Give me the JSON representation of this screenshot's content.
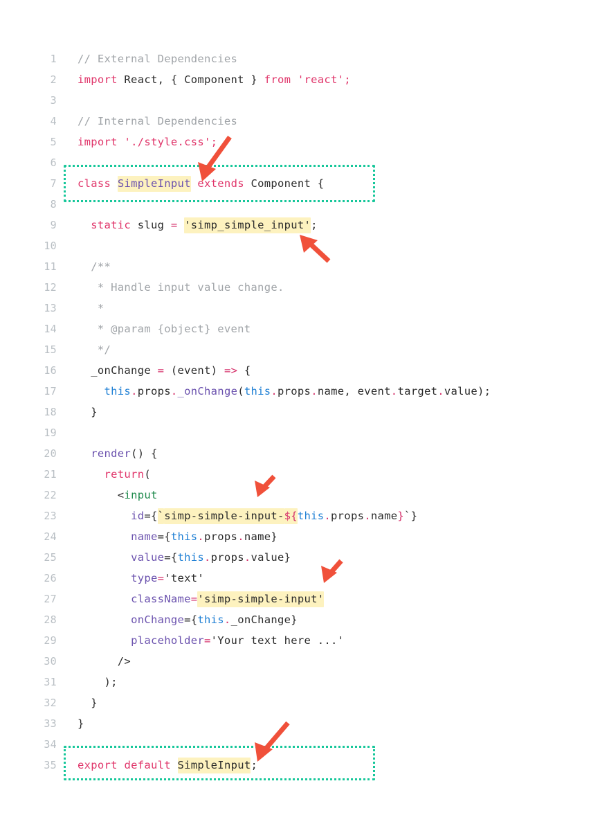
{
  "document": {
    "type": "code-screenshot",
    "language": "jsx",
    "filename_hint": "SimpleInput",
    "total_lines": 35
  },
  "colors": {
    "background": "#ffffff",
    "gutter_text": "#b9bfc4",
    "default_text": "#2b2b2b",
    "keyword": "#e0356a",
    "string": "#2b2b2b",
    "comment": "#a0a4a8",
    "class_name": "#6b52ae",
    "attribute": "#6b52ae",
    "this_keyword": "#1e7fd4",
    "jsx_tag": "#1f8a4c",
    "highlight": "#fdf2bf",
    "callout_box": "#16c79a",
    "arrow": "#f0503a"
  },
  "lines": [
    {
      "n": "1",
      "text": "// External Dependencies"
    },
    {
      "n": "2",
      "text": "import React, { Component } from 'react';"
    },
    {
      "n": "3",
      "text": ""
    },
    {
      "n": "4",
      "text": "// Internal Dependencies"
    },
    {
      "n": "5",
      "text": "import './style.css';"
    },
    {
      "n": "6",
      "text": ""
    },
    {
      "n": "7",
      "text": "class SimpleInput extends Component {"
    },
    {
      "n": "8",
      "text": ""
    },
    {
      "n": "9",
      "text": "  static slug = 'simp_simple_input';"
    },
    {
      "n": "10",
      "text": ""
    },
    {
      "n": "11",
      "text": "  /**"
    },
    {
      "n": "12",
      "text": "   * Handle input value change."
    },
    {
      "n": "13",
      "text": "   *"
    },
    {
      "n": "14",
      "text": "   * @param {object} event"
    },
    {
      "n": "15",
      "text": "   */"
    },
    {
      "n": "16",
      "text": "  _onChange = (event) => {"
    },
    {
      "n": "17",
      "text": "    this.props._onChange(this.props.name, event.target.value);"
    },
    {
      "n": "18",
      "text": "  }"
    },
    {
      "n": "19",
      "text": ""
    },
    {
      "n": "20",
      "text": "  render() {"
    },
    {
      "n": "21",
      "text": "    return("
    },
    {
      "n": "22",
      "text": "      <input"
    },
    {
      "n": "23",
      "text": "        id={`simp-simple-input-${this.props.name}`}"
    },
    {
      "n": "24",
      "text": "        name={this.props.name}"
    },
    {
      "n": "25",
      "text": "        value={this.props.value}"
    },
    {
      "n": "26",
      "text": "        type='text'"
    },
    {
      "n": "27",
      "text": "        className='simp-simple-input'"
    },
    {
      "n": "28",
      "text": "        onChange={this._onChange}"
    },
    {
      "n": "29",
      "text": "        placeholder='Your text here ...'"
    },
    {
      "n": "30",
      "text": "      />"
    },
    {
      "n": "31",
      "text": "    );"
    },
    {
      "n": "32",
      "text": "  }"
    },
    {
      "n": "33",
      "text": "}"
    },
    {
      "n": "34",
      "text": ""
    },
    {
      "n": "35",
      "text": "export default SimpleInput;"
    }
  ],
  "line_numbers": {
    "l1": "1",
    "l2": "2",
    "l3": "3",
    "l4": "4",
    "l5": "5",
    "l6": "6",
    "l7": "7",
    "l8": "8",
    "l9": "9",
    "l10": "10",
    "l11": "11",
    "l12": "12",
    "l13": "13",
    "l14": "14",
    "l15": "15",
    "l16": "16",
    "l17": "17",
    "l18": "18",
    "l19": "19",
    "l20": "20",
    "l21": "21",
    "l22": "22",
    "l23": "23",
    "l24": "24",
    "l25": "25",
    "l26": "26",
    "l27": "27",
    "l28": "28",
    "l29": "29",
    "l30": "30",
    "l31": "31",
    "l32": "32",
    "l33": "33",
    "l34": "34",
    "l35": "35"
  },
  "tokens": {
    "l1": {
      "comment": "// External Dependencies"
    },
    "l2": {
      "import": "import",
      "react_ident": " React, { Component } ",
      "from": "from",
      "space": " ",
      "module": "'react';"
    },
    "l4": {
      "comment": "// Internal Dependencies"
    },
    "l5": {
      "import": "import",
      "space": " ",
      "module": "'./style.css';"
    },
    "l7": {
      "class_kw": "class",
      "sp1": " ",
      "name": "SimpleInput",
      "sp2": " ",
      "extends_kw": "extends",
      "sp3": " ",
      "base": "Component {"
    },
    "l9": {
      "indent": "  ",
      "static_kw": "static",
      "sp1": " ",
      "ident": "slug",
      "sp2": " ",
      "eq": "=",
      "sp3": " ",
      "value": "'simp_simple_input'",
      "semi": ";"
    },
    "l11": {
      "text": "  /**"
    },
    "l12": {
      "text": "   * Handle input value change."
    },
    "l13": {
      "text": "   *"
    },
    "l14": {
      "text": "   * @param {object} event"
    },
    "l15": {
      "text": "   */"
    },
    "l16": {
      "indent": "  ",
      "ident": "_onChange",
      "sp1": " ",
      "eq": "=",
      "sp2": " ",
      "params": "(event)",
      "sp3": " ",
      "arrow": "=>",
      "brace": " {"
    },
    "l17": {
      "indent": "    ",
      "this1": "this",
      "dot1": ".",
      "props1": "props",
      "dot2": ".",
      "method": "_onChange",
      "paren": "(",
      "this2": "this",
      "dot3": ".",
      "props2": "props",
      "dot4": ".",
      "name": "name",
      "comma": ", ",
      "event": "event",
      "dot5": ".",
      "target": "target",
      "dot6": ".",
      "value": "value",
      "close": ");"
    },
    "l18": {
      "text": "  }"
    },
    "l20": {
      "indent": "  ",
      "fn": "render",
      "rest": "() {"
    },
    "l21": {
      "indent": "    ",
      "return_kw": "return",
      "paren": "("
    },
    "l22": {
      "indent": "      ",
      "lt": "<",
      "tag": "input"
    },
    "l23": {
      "indent": "        ",
      "attr": "id",
      "eqbrace": "={",
      "tick1": "`",
      "str": "simp-simple-input-",
      "dollar": "${",
      "this": "this",
      "dot1": ".",
      "props": "props",
      "dot2": ".",
      "name": "name",
      "rbrace": "}",
      "tick2": "`",
      "endbrace": "}"
    },
    "l24": {
      "indent": "        ",
      "attr": "name",
      "eqbrace": "={",
      "this": "this",
      "dot1": ".",
      "props": "props",
      "dot2": ".",
      "name": "name",
      "endbrace": "}"
    },
    "l25": {
      "indent": "        ",
      "attr": "value",
      "eqbrace": "={",
      "this": "this",
      "dot1": ".",
      "props": "props",
      "dot2": ".",
      "name": "value",
      "endbrace": "}"
    },
    "l26": {
      "indent": "        ",
      "attr": "type",
      "eq": "=",
      "str": "'text'"
    },
    "l27": {
      "indent": "        ",
      "attr": "className",
      "eq": "=",
      "str": "'simp-simple-input'"
    },
    "l28": {
      "indent": "        ",
      "attr": "onChange",
      "eqbrace": "={",
      "this": "this",
      "dot1": ".",
      "method": "_onChange",
      "endbrace": "}"
    },
    "l29": {
      "indent": "        ",
      "attr": "placeholder",
      "eq": "=",
      "str": "'Your text here ...'"
    },
    "l30": {
      "text": "      />"
    },
    "l31": {
      "text": "    );"
    },
    "l32": {
      "text": "  }"
    },
    "l33": {
      "text": "}"
    },
    "l35": {
      "export_kw": "export",
      "sp1": " ",
      "default_kw": "default",
      "sp2": " ",
      "name": "SimpleInput",
      "semi": ";"
    }
  },
  "callouts": {
    "boxes": [
      {
        "id": "class-declaration-box",
        "target_line": "7"
      },
      {
        "id": "export-default-box",
        "target_line": "35"
      }
    ],
    "arrows": [
      {
        "id": "arrow-to-class-name",
        "points_at": "SimpleInput class name on line 7"
      },
      {
        "id": "arrow-to-slug-value",
        "points_at": "'simp_simple_input' slug value on line 9"
      },
      {
        "id": "arrow-to-id-template",
        "points_at": "simp-simple-input- id template on line 23"
      },
      {
        "id": "arrow-to-classname-value",
        "points_at": "'simp-simple-input' className on line 27"
      },
      {
        "id": "arrow-to-export-name",
        "points_at": "SimpleInput in export default on line 35"
      }
    ]
  }
}
